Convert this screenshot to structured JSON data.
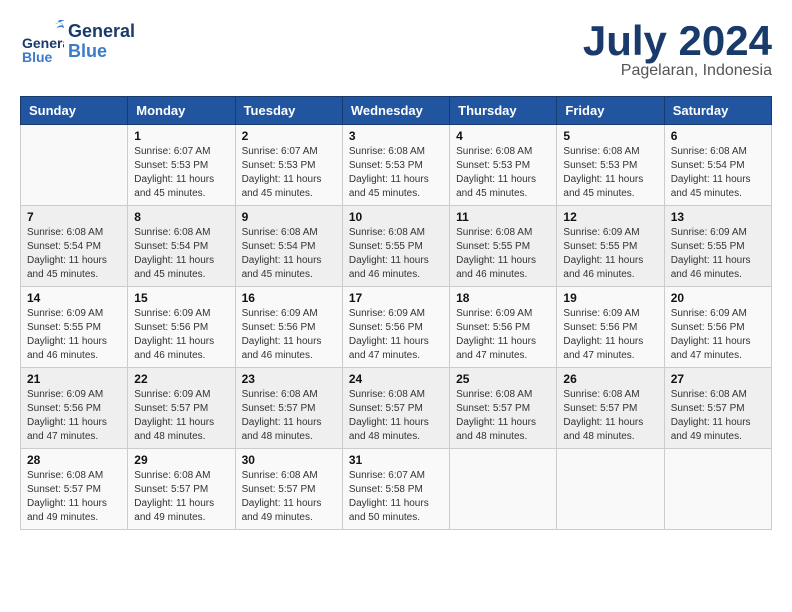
{
  "header": {
    "logo_general": "General",
    "logo_blue": "Blue",
    "month": "July 2024",
    "location": "Pagelaran, Indonesia"
  },
  "weekdays": [
    "Sunday",
    "Monday",
    "Tuesday",
    "Wednesday",
    "Thursday",
    "Friday",
    "Saturday"
  ],
  "weeks": [
    [
      {
        "day": "",
        "info": ""
      },
      {
        "day": "1",
        "info": "Sunrise: 6:07 AM\nSunset: 5:53 PM\nDaylight: 11 hours\nand 45 minutes."
      },
      {
        "day": "2",
        "info": "Sunrise: 6:07 AM\nSunset: 5:53 PM\nDaylight: 11 hours\nand 45 minutes."
      },
      {
        "day": "3",
        "info": "Sunrise: 6:08 AM\nSunset: 5:53 PM\nDaylight: 11 hours\nand 45 minutes."
      },
      {
        "day": "4",
        "info": "Sunrise: 6:08 AM\nSunset: 5:53 PM\nDaylight: 11 hours\nand 45 minutes."
      },
      {
        "day": "5",
        "info": "Sunrise: 6:08 AM\nSunset: 5:53 PM\nDaylight: 11 hours\nand 45 minutes."
      },
      {
        "day": "6",
        "info": "Sunrise: 6:08 AM\nSunset: 5:54 PM\nDaylight: 11 hours\nand 45 minutes."
      }
    ],
    [
      {
        "day": "7",
        "info": "Sunrise: 6:08 AM\nSunset: 5:54 PM\nDaylight: 11 hours\nand 45 minutes."
      },
      {
        "day": "8",
        "info": "Sunrise: 6:08 AM\nSunset: 5:54 PM\nDaylight: 11 hours\nand 45 minutes."
      },
      {
        "day": "9",
        "info": "Sunrise: 6:08 AM\nSunset: 5:54 PM\nDaylight: 11 hours\nand 45 minutes."
      },
      {
        "day": "10",
        "info": "Sunrise: 6:08 AM\nSunset: 5:55 PM\nDaylight: 11 hours\nand 46 minutes."
      },
      {
        "day": "11",
        "info": "Sunrise: 6:08 AM\nSunset: 5:55 PM\nDaylight: 11 hours\nand 46 minutes."
      },
      {
        "day": "12",
        "info": "Sunrise: 6:09 AM\nSunset: 5:55 PM\nDaylight: 11 hours\nand 46 minutes."
      },
      {
        "day": "13",
        "info": "Sunrise: 6:09 AM\nSunset: 5:55 PM\nDaylight: 11 hours\nand 46 minutes."
      }
    ],
    [
      {
        "day": "14",
        "info": "Sunrise: 6:09 AM\nSunset: 5:55 PM\nDaylight: 11 hours\nand 46 minutes."
      },
      {
        "day": "15",
        "info": "Sunrise: 6:09 AM\nSunset: 5:56 PM\nDaylight: 11 hours\nand 46 minutes."
      },
      {
        "day": "16",
        "info": "Sunrise: 6:09 AM\nSunset: 5:56 PM\nDaylight: 11 hours\nand 46 minutes."
      },
      {
        "day": "17",
        "info": "Sunrise: 6:09 AM\nSunset: 5:56 PM\nDaylight: 11 hours\nand 47 minutes."
      },
      {
        "day": "18",
        "info": "Sunrise: 6:09 AM\nSunset: 5:56 PM\nDaylight: 11 hours\nand 47 minutes."
      },
      {
        "day": "19",
        "info": "Sunrise: 6:09 AM\nSunset: 5:56 PM\nDaylight: 11 hours\nand 47 minutes."
      },
      {
        "day": "20",
        "info": "Sunrise: 6:09 AM\nSunset: 5:56 PM\nDaylight: 11 hours\nand 47 minutes."
      }
    ],
    [
      {
        "day": "21",
        "info": "Sunrise: 6:09 AM\nSunset: 5:56 PM\nDaylight: 11 hours\nand 47 minutes."
      },
      {
        "day": "22",
        "info": "Sunrise: 6:09 AM\nSunset: 5:57 PM\nDaylight: 11 hours\nand 48 minutes."
      },
      {
        "day": "23",
        "info": "Sunrise: 6:08 AM\nSunset: 5:57 PM\nDaylight: 11 hours\nand 48 minutes."
      },
      {
        "day": "24",
        "info": "Sunrise: 6:08 AM\nSunset: 5:57 PM\nDaylight: 11 hours\nand 48 minutes."
      },
      {
        "day": "25",
        "info": "Sunrise: 6:08 AM\nSunset: 5:57 PM\nDaylight: 11 hours\nand 48 minutes."
      },
      {
        "day": "26",
        "info": "Sunrise: 6:08 AM\nSunset: 5:57 PM\nDaylight: 11 hours\nand 48 minutes."
      },
      {
        "day": "27",
        "info": "Sunrise: 6:08 AM\nSunset: 5:57 PM\nDaylight: 11 hours\nand 49 minutes."
      }
    ],
    [
      {
        "day": "28",
        "info": "Sunrise: 6:08 AM\nSunset: 5:57 PM\nDaylight: 11 hours\nand 49 minutes."
      },
      {
        "day": "29",
        "info": "Sunrise: 6:08 AM\nSunset: 5:57 PM\nDaylight: 11 hours\nand 49 minutes."
      },
      {
        "day": "30",
        "info": "Sunrise: 6:08 AM\nSunset: 5:57 PM\nDaylight: 11 hours\nand 49 minutes."
      },
      {
        "day": "31",
        "info": "Sunrise: 6:07 AM\nSunset: 5:58 PM\nDaylight: 11 hours\nand 50 minutes."
      },
      {
        "day": "",
        "info": ""
      },
      {
        "day": "",
        "info": ""
      },
      {
        "day": "",
        "info": ""
      }
    ]
  ]
}
